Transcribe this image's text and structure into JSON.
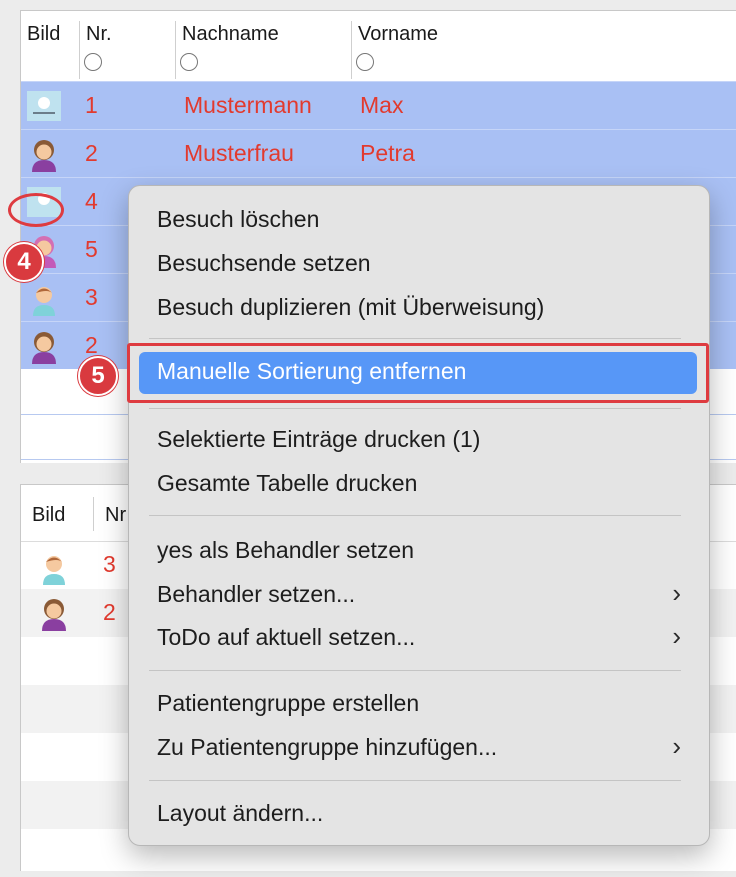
{
  "top_table": {
    "headers": {
      "image": "Bild",
      "nr": "Nr.",
      "lastname": "Nachname",
      "firstname": "Vorname"
    },
    "rows": [
      {
        "nr": "1",
        "lastname": "Mustermann",
        "firstname": "Max",
        "avatar": "logo-placeholder-icon"
      },
      {
        "nr": "2",
        "lastname": "Musterfrau",
        "firstname": "Petra",
        "avatar": "female-avatar-icon"
      },
      {
        "nr": "4",
        "lastname": "",
        "firstname": "",
        "avatar": "logo-placeholder-icon"
      },
      {
        "nr": "5",
        "lastname": "",
        "firstname": "",
        "avatar": "female-avatar-icon"
      },
      {
        "nr": "3",
        "lastname": "",
        "firstname": "",
        "avatar": "male-avatar-icon"
      },
      {
        "nr": "2",
        "lastname": "",
        "firstname": "",
        "avatar": "female-avatar-icon"
      }
    ]
  },
  "bottom_table": {
    "headers": {
      "image": "Bild",
      "nr": "Nr"
    },
    "rows": [
      {
        "nr": "3",
        "avatar": "male-avatar-icon"
      },
      {
        "nr": "2",
        "avatar": "female-avatar-icon"
      }
    ]
  },
  "context_menu": {
    "items": {
      "delete_visit": "Besuch löschen",
      "set_visit_end": "Besuchsende setzen",
      "duplicate_visit": "Besuch duplizieren (mit Überweisung)",
      "remove_manual_sort": "Manuelle Sortierung entfernen",
      "print_selected": "Selektierte Einträge drucken (1)",
      "print_table": "Gesamte Tabelle drucken",
      "set_yes_practitioner": "yes als Behandler setzen",
      "set_practitioner": "Behandler setzen...",
      "set_todo_current": "ToDo auf aktuell setzen...",
      "create_patient_group": "Patientengruppe erstellen",
      "add_to_patient_group": "Zu Patientengruppe hinzufügen...",
      "change_layout": "Layout ändern..."
    },
    "highlight_color": "#5797f7"
  },
  "annotations": {
    "step4": "4",
    "step5": "5",
    "accent": "#d93a3f"
  },
  "colors": {
    "selection": "#a9c0f4",
    "text_red": "#e23a2e"
  }
}
